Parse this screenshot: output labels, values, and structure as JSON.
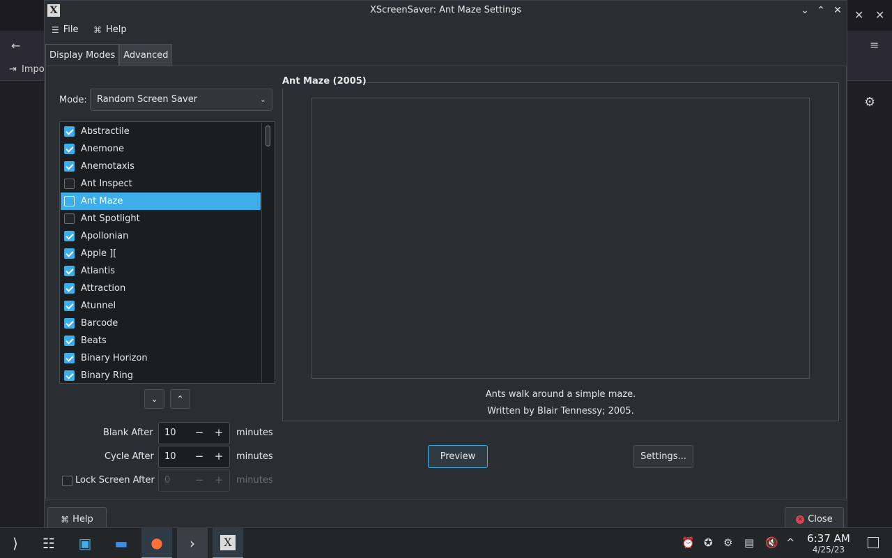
{
  "background_browser": {
    "bookmark_label": "Impo"
  },
  "window": {
    "title": "XScreenSaver: Ant Maze Settings",
    "menu": {
      "file": "File",
      "help": "Help"
    },
    "tabs": [
      {
        "label": "Display Modes",
        "active": true
      },
      {
        "label": "Advanced",
        "active": false
      }
    ]
  },
  "display_modes": {
    "mode_label": "Mode:",
    "mode_value": "Random Screen Saver",
    "screensavers": [
      {
        "name": "Abstractile",
        "checked": true
      },
      {
        "name": "Anemone",
        "checked": true
      },
      {
        "name": "Anemotaxis",
        "checked": true
      },
      {
        "name": "Ant Inspect",
        "checked": false
      },
      {
        "name": "Ant Maze",
        "checked": false,
        "selected": true
      },
      {
        "name": "Ant Spotlight",
        "checked": false
      },
      {
        "name": "Apollonian",
        "checked": true
      },
      {
        "name": "Apple ][",
        "checked": true
      },
      {
        "name": "Atlantis",
        "checked": true
      },
      {
        "name": "Attraction",
        "checked": true
      },
      {
        "name": "Atunnel",
        "checked": true
      },
      {
        "name": "Barcode",
        "checked": true
      },
      {
        "name": "Beats",
        "checked": true
      },
      {
        "name": "Binary Horizon",
        "checked": true
      },
      {
        "name": "Binary Ring",
        "checked": true
      }
    ],
    "blank_after": {
      "label": "Blank After",
      "value": "10",
      "unit": "minutes"
    },
    "cycle_after": {
      "label": "Cycle After",
      "value": "10",
      "unit": "minutes"
    },
    "lock_after": {
      "label": "Lock Screen After",
      "value": "0",
      "unit": "minutes",
      "checked": false
    }
  },
  "preview_panel": {
    "group_title": "Ant Maze (2005)",
    "description": "Ants walk around a simple maze.",
    "credit": "Written by Blair Tennessy; 2005.",
    "preview_button": "Preview",
    "settings_button": "Settings..."
  },
  "footer": {
    "help_button": "Help",
    "close_button": "Close"
  },
  "taskbar": {
    "time": "6:37 AM",
    "date": "4/25/23"
  }
}
